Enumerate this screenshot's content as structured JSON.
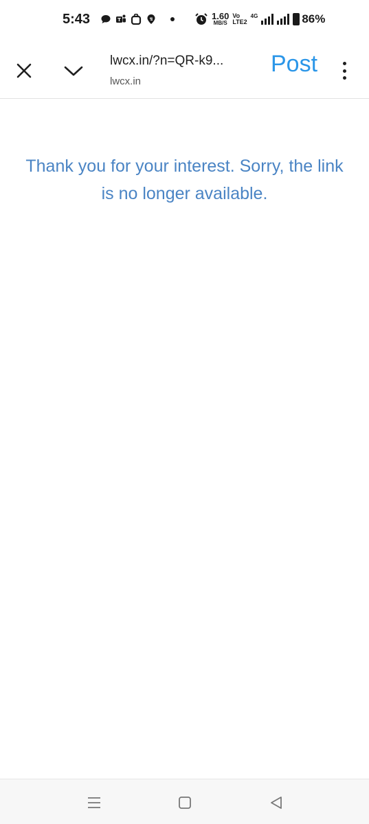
{
  "status_bar": {
    "time": "5:43",
    "notification_icons": [
      "chat-bubble-icon",
      "teams-icon",
      "shopping-bag-icon",
      "swiggy-icon"
    ],
    "speed_value": "1.60",
    "speed_unit": "MB/S",
    "volte_top": "Vo",
    "volte_bottom": "LTE2",
    "network_type": "4G",
    "battery": "86%"
  },
  "header": {
    "url": "lwcx.in/?n=QR-k9...",
    "domain": "lwcx.in",
    "post_label": "Post"
  },
  "content": {
    "message": "Thank you for your interest. Sorry, the link is no longer available."
  },
  "colors": {
    "accent_post": "#2b96e8",
    "message_text": "#4a84c4"
  }
}
